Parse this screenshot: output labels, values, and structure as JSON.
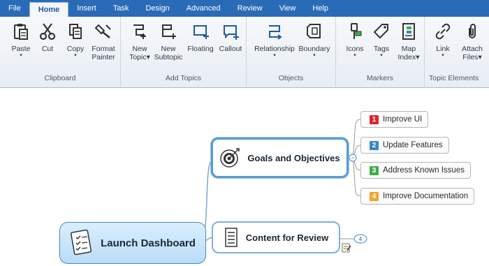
{
  "menu": {
    "tabs": [
      "File",
      "Home",
      "Insert",
      "Task",
      "Design",
      "Advanced",
      "Review",
      "View",
      "Help"
    ],
    "active_tab": "Home"
  },
  "ribbon": {
    "clipboard": {
      "label": "Clipboard",
      "paste": "Paste",
      "cut": "Cut",
      "copy": "Copy",
      "format_painter_1": "Format",
      "format_painter_2": "Painter"
    },
    "add_topics": {
      "label": "Add Topics",
      "new_topic_1": "New",
      "new_topic_2": "Topic",
      "new_subtopic_1": "New",
      "new_subtopic_2": "Subtopic",
      "floating": "Floating",
      "callout": "Callout"
    },
    "objects": {
      "label": "Objects",
      "relationship": "Relationship",
      "boundary": "Boundary"
    },
    "markers": {
      "label": "Markers",
      "icons": "Icons",
      "tags": "Tags",
      "map_index_1": "Map",
      "map_index_2": "Index"
    },
    "topic_elements": {
      "label": "Topic Elements",
      "link": "Link",
      "attach_1": "Attach",
      "attach_2": "Files"
    },
    "dropdown_caret": "▾"
  },
  "map": {
    "central": "Launch Dashboard",
    "goals": "Goals and Objectives",
    "content": "Content for Review",
    "content_count": "4",
    "collapse_symbol": "−",
    "subtopics": [
      {
        "num": "1",
        "label": "Improve UI",
        "color": "#d9262c"
      },
      {
        "num": "2",
        "label": "Update Features",
        "color": "#3a86c6"
      },
      {
        "num": "3",
        "label": "Address Known Issues",
        "color": "#3fae49"
      },
      {
        "num": "4",
        "label": "Improve Documentation",
        "color": "#f2a531"
      }
    ]
  }
}
